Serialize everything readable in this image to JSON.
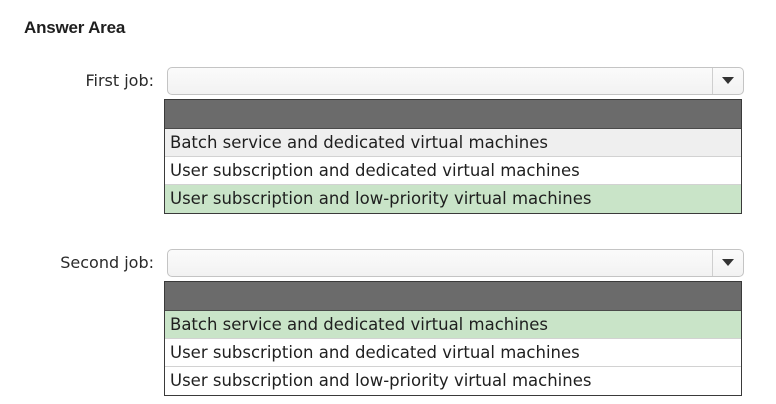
{
  "title": "Answer Area",
  "jobs": [
    {
      "label": "First job:",
      "options": [
        "Batch service and dedicated virtual machines",
        "User subscription and dedicated virtual machines",
        "User subscription and low-priority virtual machines"
      ],
      "selected_option": "User subscription and low-priority virtual machines"
    },
    {
      "label": "Second job:",
      "options": [
        "Batch service and dedicated virtual machines",
        "User subscription and dedicated virtual machines",
        "User subscription and low-priority virtual machines"
      ],
      "selected_option": "Batch service and dedicated virtual machines"
    }
  ],
  "icons": {
    "dropdown": "chevron-down-icon"
  },
  "colors": {
    "selected_background": "#c9e4c8",
    "header_bar": "#6b6b6b"
  }
}
